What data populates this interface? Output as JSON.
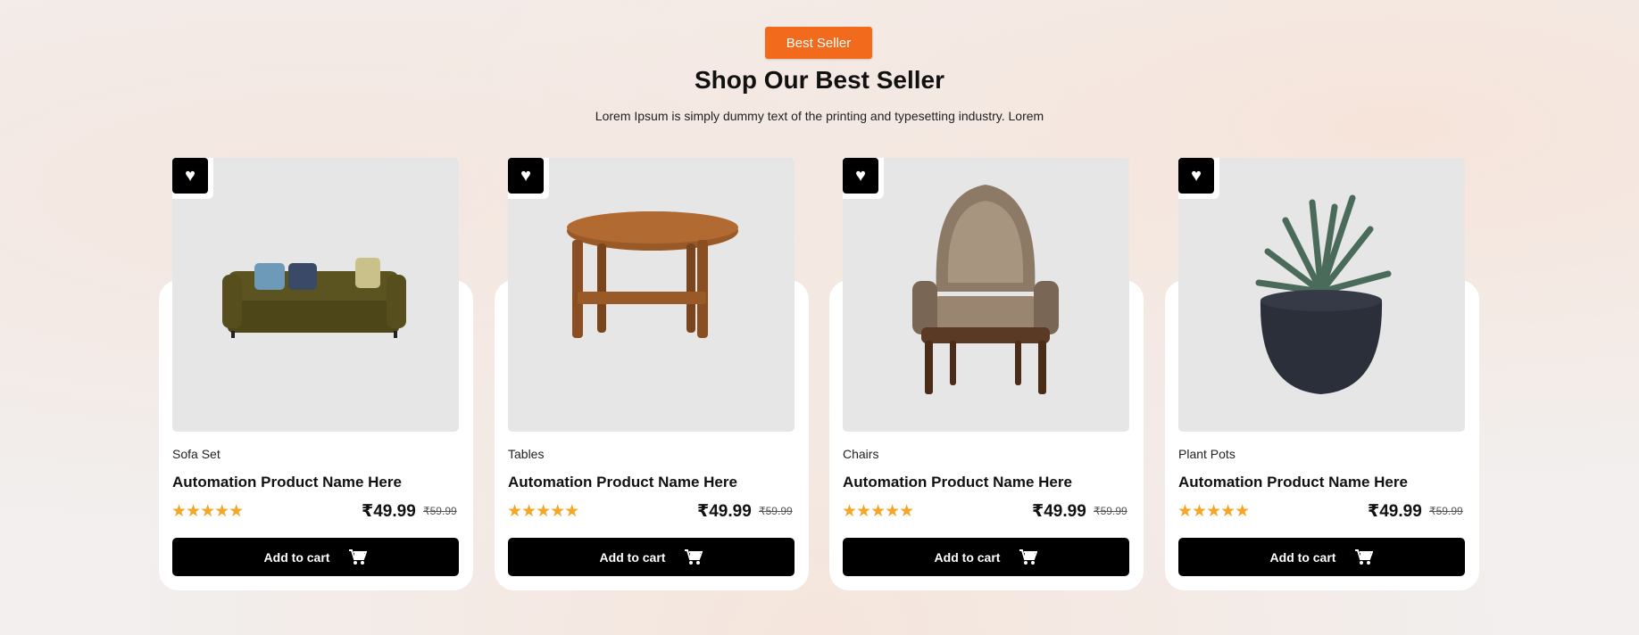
{
  "header": {
    "badge": "Best Seller",
    "title": "Shop Our Best Seller",
    "subtitle": "Lorem Ipsum is simply dummy text of the printing and typesetting industry. Lorem"
  },
  "products": [
    {
      "category": "Sofa Set",
      "name": "Automation Product Name Here",
      "rating": 5,
      "stars": "★★★★★",
      "price": "₹49.99",
      "old_price": "₹59.99",
      "cta": "Add to cart",
      "image": "sofa"
    },
    {
      "category": "Tables",
      "name": "Automation Product Name Here",
      "rating": 5,
      "stars": "★★★★★",
      "price": "₹49.99",
      "old_price": "₹59.99",
      "cta": "Add to cart",
      "image": "table"
    },
    {
      "category": "Chairs",
      "name": "Automation Product Name Here",
      "rating": 5,
      "stars": "★★★★★",
      "price": "₹49.99",
      "old_price": "₹59.99",
      "cta": "Add to cart",
      "image": "chair"
    },
    {
      "category": "Plant Pots",
      "name": "Automation Product Name Here",
      "rating": 5,
      "stars": "★★★★★",
      "price": "₹49.99",
      "old_price": "₹59.99",
      "cta": "Add to cart",
      "image": "plant-pot"
    }
  ],
  "colors": {
    "accent": "#f26a1b",
    "star": "#f5a623",
    "button": "#000000"
  }
}
